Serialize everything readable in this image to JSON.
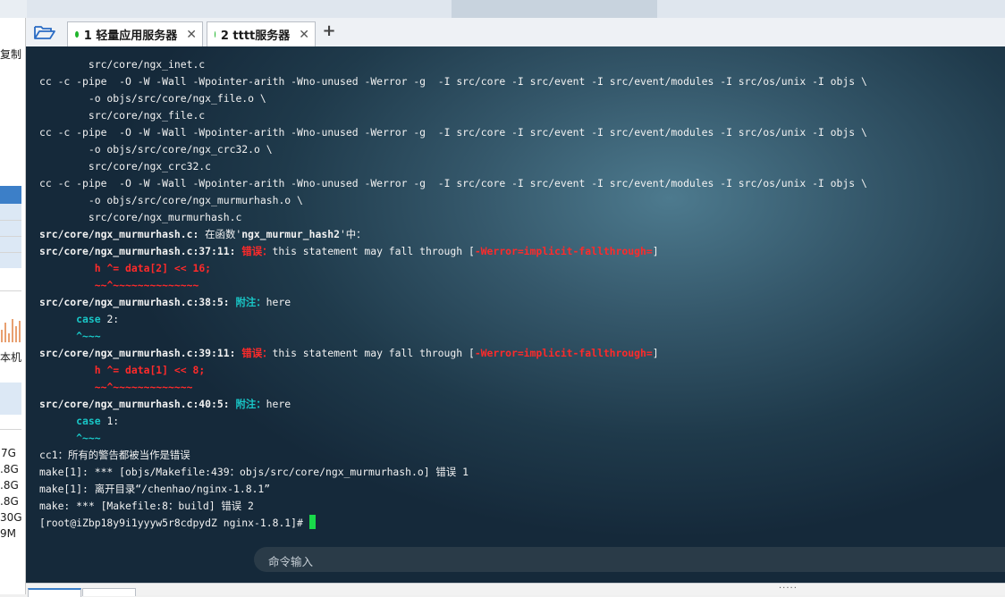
{
  "left_panel": {
    "copy_label": "复制",
    "local_label": "本机",
    "sizes": [
      "7G",
      ".8G",
      ".8G",
      ".8G",
      "30G",
      "9M"
    ]
  },
  "tabs": [
    {
      "label": "1 轻量应用服务器",
      "active": true
    },
    {
      "label": "2 tttt服务器",
      "active": false
    }
  ],
  "add_tab_label": "+",
  "terminal": {
    "lines": [
      [
        {
          "t": "        src/core/ngx_inet.c"
        }
      ],
      [
        {
          "t": "cc -c -pipe  -O -W -Wall -Wpointer-arith -Wno-unused -Werror -g  -I src/core -I src/event -I src/event/modules -I src/os/unix -I objs \\"
        }
      ],
      [
        {
          "t": "        -o objs/src/core/ngx_file.o \\"
        }
      ],
      [
        {
          "t": "        src/core/ngx_file.c"
        }
      ],
      [
        {
          "t": "cc -c -pipe  -O -W -Wall -Wpointer-arith -Wno-unused -Werror -g  -I src/core -I src/event -I src/event/modules -I src/os/unix -I objs \\"
        }
      ],
      [
        {
          "t": "        -o objs/src/core/ngx_crc32.o \\"
        }
      ],
      [
        {
          "t": "        src/core/ngx_crc32.c"
        }
      ],
      [
        {
          "t": "cc -c -pipe  -O -W -Wall -Wpointer-arith -Wno-unused -Werror -g  -I src/core -I src/event -I src/event/modules -I src/os/unix -I objs \\"
        }
      ],
      [
        {
          "t": "        -o objs/src/core/ngx_murmurhash.o \\"
        }
      ],
      [
        {
          "t": "        src/core/ngx_murmurhash.c"
        }
      ],
      [
        {
          "t": "src/core/ngx_murmurhash.c:",
          "s": "b"
        },
        {
          "t": " 在函数'"
        },
        {
          "t": "ngx_murmur_hash2",
          "s": "b"
        },
        {
          "t": "'中："
        }
      ],
      [
        {
          "t": "src/core/ngx_murmurhash.c:37:11: ",
          "s": "b"
        },
        {
          "t": "错误：",
          "s": "red"
        },
        {
          "t": "this statement may fall through ["
        },
        {
          "t": "-Werror=implicit-fallthrough=",
          "s": "red"
        },
        {
          "t": "]"
        }
      ],
      [
        {
          "t": "         "
        },
        {
          "t": "h ^= data[2] << 16;",
          "s": "red"
        }
      ],
      [
        {
          "t": "         "
        },
        {
          "t": "~~^~~~~~~~~~~~~~~",
          "s": "red"
        }
      ],
      [
        {
          "t": "src/core/ngx_murmurhash.c:38:5: ",
          "s": "b"
        },
        {
          "t": "附注：",
          "s": "cyan"
        },
        {
          "t": "here"
        }
      ],
      [
        {
          "t": "      "
        },
        {
          "t": "case",
          "s": "cyan"
        },
        {
          "t": " 2:"
        }
      ],
      [
        {
          "t": "      "
        },
        {
          "t": "^~~~",
          "s": "cyan"
        }
      ],
      [
        {
          "t": "src/core/ngx_murmurhash.c:39:11: ",
          "s": "b"
        },
        {
          "t": "错误：",
          "s": "red"
        },
        {
          "t": "this statement may fall through ["
        },
        {
          "t": "-Werror=implicit-fallthrough=",
          "s": "red"
        },
        {
          "t": "]"
        }
      ],
      [
        {
          "t": "         "
        },
        {
          "t": "h ^= data[1] << 8;",
          "s": "red"
        }
      ],
      [
        {
          "t": "         "
        },
        {
          "t": "~~^~~~~~~~~~~~~~",
          "s": "red"
        }
      ],
      [
        {
          "t": "src/core/ngx_murmurhash.c:40:5: ",
          "s": "b"
        },
        {
          "t": "附注：",
          "s": "cyan"
        },
        {
          "t": "here"
        }
      ],
      [
        {
          "t": "      "
        },
        {
          "t": "case",
          "s": "cyan"
        },
        {
          "t": " 1:"
        }
      ],
      [
        {
          "t": "      "
        },
        {
          "t": "^~~~",
          "s": "cyan"
        }
      ],
      [
        {
          "t": "cc1：所有的警告都被当作是错误"
        }
      ],
      [
        {
          "t": "make[1]: *** [objs/Makefile:439：objs/src/core/ngx_murmurhash.o] 错误 1"
        }
      ],
      [
        {
          "t": "make[1]: 离开目录“/chenhao/nginx-1.8.1”"
        }
      ],
      [
        {
          "t": "make: *** [Makefile:8：build] 错误 2"
        }
      ],
      [
        {
          "t": "[root@iZbp18y9i1yyyw5r8cdpydZ nginx-1.8.1]# "
        }
      ]
    ]
  },
  "command_input": {
    "placeholder": "命令输入"
  },
  "colors": {
    "cursor": "#19d94a",
    "error_red": "#ff2a2a",
    "note_cyan": "#19c6c6",
    "status_dot": "#1fb52b"
  }
}
